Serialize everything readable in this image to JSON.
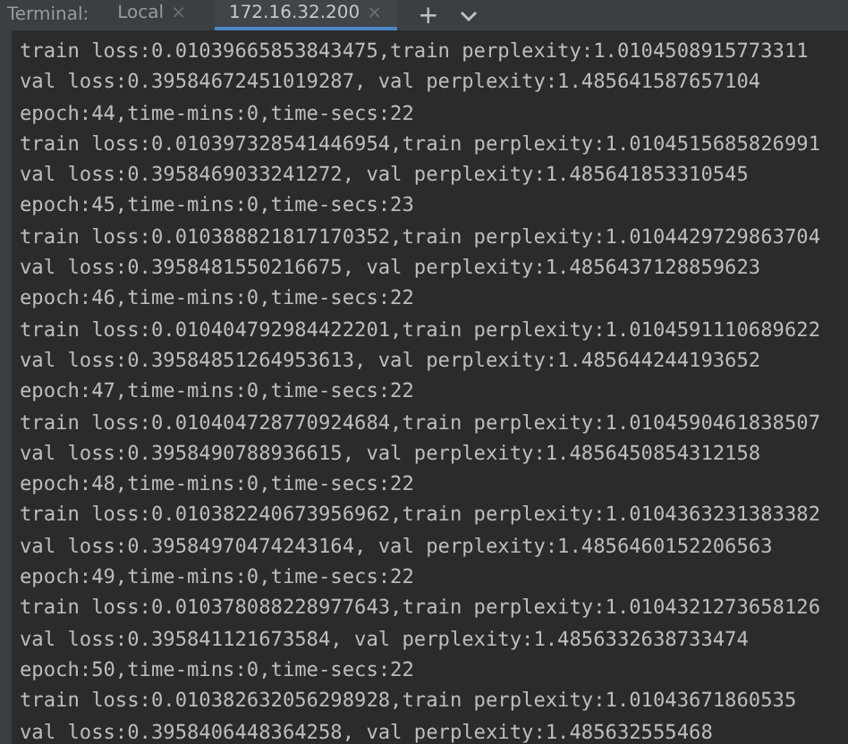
{
  "terminal": {
    "label": "Terminal:",
    "tabs": [
      {
        "label": "Local",
        "close": "×",
        "selected": false
      },
      {
        "label": "172.16.32.200",
        "close": "×",
        "selected": true
      }
    ],
    "add_button": "+",
    "lines": [
      "train loss:0.01039665853843475,train perplexity:1.0104508915773311",
      "val loss:0.39584672451019287, val perplexity:1.485641587657104",
      "epoch:44,time-mins:0,time-secs:22",
      "train loss:0.010397328541446954,train perplexity:1.0104515685826991",
      "val loss:0.3958469033241272, val perplexity:1.485641853310545",
      "epoch:45,time-mins:0,time-secs:23",
      "train loss:0.010388821817170352,train perplexity:1.0104429729863704",
      "val loss:0.3958481550216675, val perplexity:1.4856437128859623",
      "epoch:46,time-mins:0,time-secs:22",
      "train loss:0.010404792984422201,train perplexity:1.0104591110689622",
      "val loss:0.39584851264953613, val perplexity:1.485644244193652",
      "epoch:47,time-mins:0,time-secs:22",
      "train loss:0.010404728770924684,train perplexity:1.0104590461838507",
      "val loss:0.3958490788936615, val perplexity:1.4856450854312158",
      "epoch:48,time-mins:0,time-secs:22",
      "train loss:0.010382240673956962,train perplexity:1.0104363231383382",
      "val loss:0.39584970474243164, val perplexity:1.4856460152206563",
      "epoch:49,time-mins:0,time-secs:22",
      "train loss:0.010378088228977643,train perplexity:1.0104321273658126",
      "val loss:0.395841121673584, val perplexity:1.4856332638733474",
      "epoch:50,time-mins:0,time-secs:22",
      "train loss:0.010382632056298928,train perplexity:1.01043671860535",
      "val loss:0.3958406448364258, val perplexity:1.485632555468"
    ]
  }
}
